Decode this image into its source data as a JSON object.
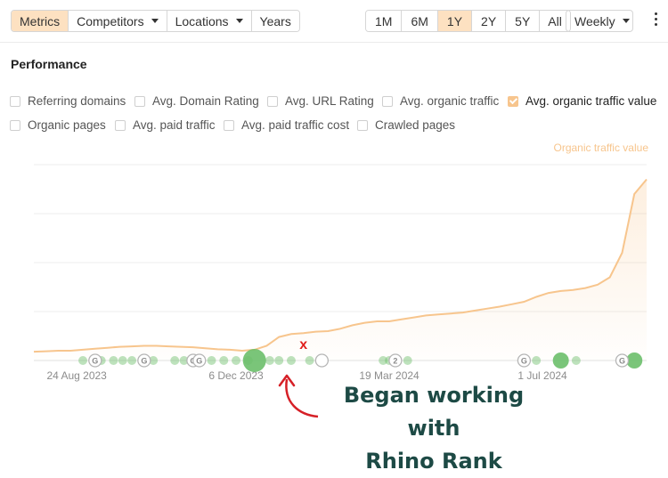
{
  "toolbar": {
    "tabs": [
      {
        "label": "Metrics",
        "active": true,
        "dropdown": false
      },
      {
        "label": "Competitors",
        "active": false,
        "dropdown": true
      },
      {
        "label": "Locations",
        "active": false,
        "dropdown": true
      },
      {
        "label": "Years",
        "active": false,
        "dropdown": false
      }
    ],
    "ranges": [
      {
        "label": "1M",
        "active": false
      },
      {
        "label": "6M",
        "active": false
      },
      {
        "label": "1Y",
        "active": true
      },
      {
        "label": "2Y",
        "active": false
      },
      {
        "label": "5Y",
        "active": false
      },
      {
        "label": "All",
        "active": false
      }
    ],
    "interval": "Weekly",
    "active_color": "#fde1c1"
  },
  "section": {
    "title": "Performance"
  },
  "metrics": [
    {
      "label": "Referring domains",
      "checked": false
    },
    {
      "label": "Avg. Domain Rating",
      "checked": false
    },
    {
      "label": "Avg. URL Rating",
      "checked": false
    },
    {
      "label": "Avg. organic traffic",
      "checked": false
    },
    {
      "label": "Avg. organic traffic value",
      "checked": true
    },
    {
      "label": "Organic pages",
      "checked": false
    },
    {
      "label": "Avg. paid traffic",
      "checked": false
    },
    {
      "label": "Avg. paid traffic cost",
      "checked": false
    },
    {
      "label": "Crawled pages",
      "checked": false
    }
  ],
  "chart_data": {
    "type": "area",
    "series": [
      {
        "name": "Organic traffic value",
        "color": "#f7c58d",
        "x": [
          0,
          2,
          4,
          6,
          8,
          10,
          12,
          14,
          16,
          18,
          20,
          22,
          24,
          26,
          28,
          30,
          32,
          34,
          36,
          38,
          40,
          42,
          44,
          46,
          48,
          50,
          52,
          54,
          56,
          58,
          60,
          62,
          64,
          66,
          68,
          70,
          72,
          74,
          76,
          78,
          80,
          82,
          84,
          86,
          88,
          90,
          92,
          94,
          96,
          98,
          100
        ],
        "values": [
          1.8,
          1.9,
          2.0,
          2.0,
          2.2,
          2.4,
          2.6,
          2.8,
          2.9,
          3.0,
          3.0,
          2.9,
          2.8,
          2.7,
          2.5,
          2.3,
          2.2,
          2.0,
          2.2,
          3.0,
          4.8,
          5.4,
          5.6,
          5.9,
          6.0,
          6.5,
          7.2,
          7.7,
          8.0,
          8.0,
          8.4,
          8.8,
          9.2,
          9.4,
          9.6,
          9.8,
          10.2,
          10.6,
          11.0,
          11.5,
          12.0,
          13.0,
          13.8,
          14.2,
          14.4,
          14.8,
          15.5,
          17.0,
          22.0,
          34.0,
          37.0
        ]
      }
    ],
    "x_ticks": [
      {
        "label": "24 Aug 2023",
        "at": 7
      },
      {
        "label": "6 Dec 2023",
        "at": 33
      },
      {
        "label": "19 Mar 2024",
        "at": 58
      },
      {
        "label": "1 Jul 2024",
        "at": 83
      }
    ],
    "ylim": [
      0,
      40
    ],
    "grid": true,
    "legend": "Organic traffic value",
    "events": {
      "google_updates": [
        {
          "at": 10,
          "label": "G",
          "type": "google"
        },
        {
          "at": 18,
          "label": "G",
          "type": "google"
        },
        {
          "at": 26,
          "label": "G",
          "type": "google"
        },
        {
          "at": 27,
          "label": "G",
          "type": "google"
        },
        {
          "at": 47,
          "label": "",
          "type": "google"
        },
        {
          "at": 59,
          "label": "2",
          "type": "google"
        },
        {
          "at": 80,
          "label": "G",
          "type": "google"
        },
        {
          "at": 96,
          "label": "G",
          "type": "google"
        }
      ],
      "dots": [
        {
          "at": 8,
          "size": "s"
        },
        {
          "at": 11,
          "size": "s"
        },
        {
          "at": 13,
          "size": "s"
        },
        {
          "at": 14.5,
          "size": "s"
        },
        {
          "at": 16,
          "size": "s"
        },
        {
          "at": 19.5,
          "size": "s"
        },
        {
          "at": 23,
          "size": "s"
        },
        {
          "at": 24.5,
          "size": "s"
        },
        {
          "at": 29,
          "size": "s"
        },
        {
          "at": 31,
          "size": "s"
        },
        {
          "at": 33,
          "size": "s"
        },
        {
          "at": 35,
          "size": "s"
        },
        {
          "at": 36,
          "size": "l"
        },
        {
          "at": 38.5,
          "size": "s"
        },
        {
          "at": 40,
          "size": "s"
        },
        {
          "at": 42,
          "size": "s"
        },
        {
          "at": 45,
          "size": "s"
        },
        {
          "at": 57,
          "size": "s"
        },
        {
          "at": 58,
          "size": "s"
        },
        {
          "at": 61,
          "size": "s"
        },
        {
          "at": 82,
          "size": "s"
        },
        {
          "at": 86,
          "size": "m"
        },
        {
          "at": 88.5,
          "size": "s"
        },
        {
          "at": 98,
          "size": "m"
        }
      ]
    },
    "marker": {
      "at": 44,
      "label": "x",
      "color": "#e0201e"
    }
  },
  "annotation": {
    "line1": "Began working with",
    "line2": "Rhino Rank",
    "color": "#1d4a45",
    "arrow_color": "#d62027"
  }
}
